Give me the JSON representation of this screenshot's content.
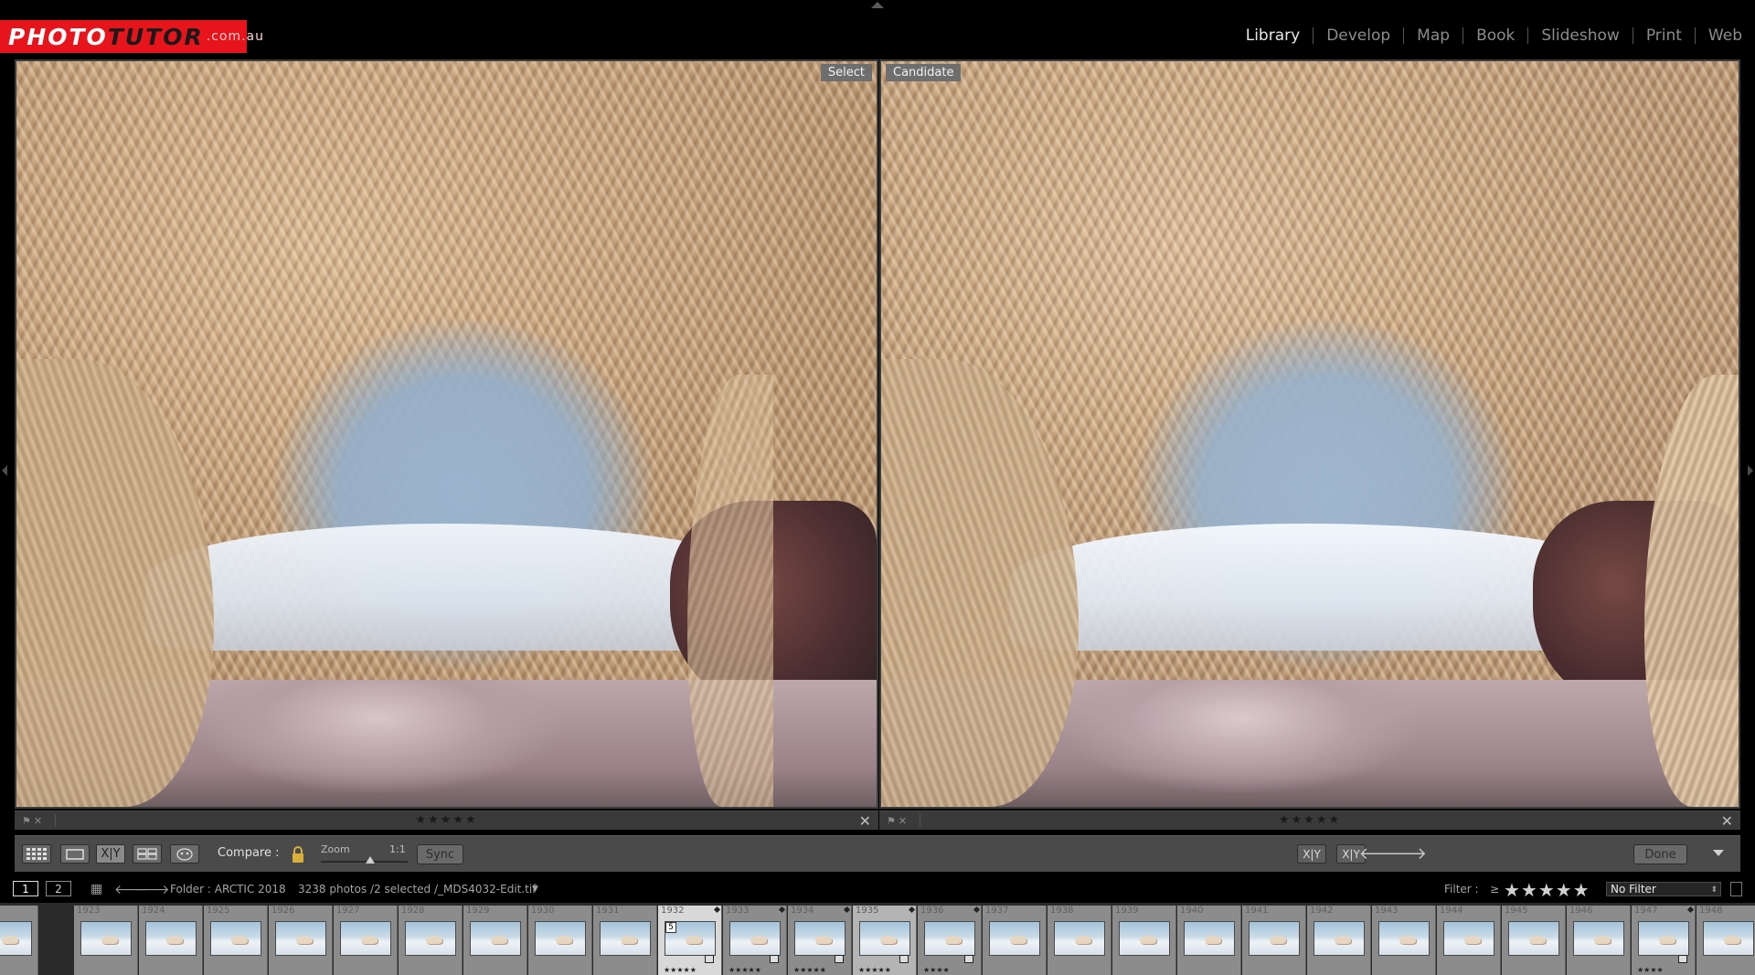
{
  "header": {
    "logo": {
      "part1": "PHOTO",
      "part2": "TUTOR",
      "part3": ".com.au"
    },
    "modules": [
      "Library",
      "Develop",
      "Map",
      "Book",
      "Slideshow",
      "Print",
      "Web"
    ],
    "active_module": "Library"
  },
  "compare": {
    "left": {
      "tag": "Select",
      "stars": "★★★★★"
    },
    "right": {
      "tag": "Candidate",
      "stars": "★★★★★"
    }
  },
  "toolbar": {
    "compare_label": "Compare :",
    "zoom_label": "Zoom",
    "zoom_value": "1:1",
    "sync_label": "Sync",
    "done_label": "Done",
    "xy_label": "X|Y"
  },
  "filmstrip_header": {
    "page1": "1",
    "page2": "2",
    "folder": "Folder : ARCTIC 2018",
    "count": "3238 photos /2 selected /_MDS4032-Edit.tif",
    "filter_label": "Filter :",
    "filter_op": "≥",
    "filter_stars": "★★★★★",
    "filter_value": "No Filter"
  },
  "filmstrip": {
    "cells": [
      {
        "num": "",
        "stars": "",
        "state": ""
      },
      {
        "num": "1923",
        "stars": "",
        "state": ""
      },
      {
        "num": "1924",
        "stars": "",
        "state": ""
      },
      {
        "num": "1925",
        "stars": "",
        "state": ""
      },
      {
        "num": "1926",
        "stars": "",
        "state": ""
      },
      {
        "num": "1927",
        "stars": "",
        "state": ""
      },
      {
        "num": "1928",
        "stars": "",
        "state": ""
      },
      {
        "num": "1929",
        "stars": "",
        "state": ""
      },
      {
        "num": "1930",
        "stars": "",
        "state": ""
      },
      {
        "num": "1931",
        "stars": "",
        "state": ""
      },
      {
        "num": "1932",
        "stars": "★★★★★",
        "state": "primary",
        "badge": "5"
      },
      {
        "num": "1933",
        "stars": "★★★★★",
        "state": ""
      },
      {
        "num": "1934",
        "stars": "★★★★★",
        "state": ""
      },
      {
        "num": "1935",
        "stars": "★★★★★",
        "state": "selected"
      },
      {
        "num": "1936",
        "stars": "★★★★",
        "state": ""
      },
      {
        "num": "1937",
        "stars": "",
        "state": ""
      },
      {
        "num": "1938",
        "stars": "",
        "state": ""
      },
      {
        "num": "1939",
        "stars": "",
        "state": ""
      },
      {
        "num": "1940",
        "stars": "",
        "state": ""
      },
      {
        "num": "1941",
        "stars": "",
        "state": ""
      },
      {
        "num": "1942",
        "stars": "",
        "state": ""
      },
      {
        "num": "1943",
        "stars": "",
        "state": ""
      },
      {
        "num": "1944",
        "stars": "",
        "state": ""
      },
      {
        "num": "1945",
        "stars": "",
        "state": ""
      },
      {
        "num": "1946",
        "stars": "",
        "state": ""
      },
      {
        "num": "1947",
        "stars": "★★★★",
        "state": ""
      },
      {
        "num": "1948",
        "stars": "",
        "state": ""
      }
    ]
  },
  "colors": {
    "logo_red": "#e8141c",
    "background": "#000000",
    "toolbar": "#4a4a4a",
    "filmstrip_cell": "#8c8c8c"
  }
}
